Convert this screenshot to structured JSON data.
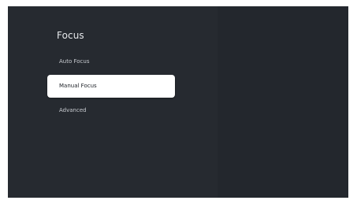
{
  "panel": {
    "title": "Focus"
  },
  "menu": {
    "items": [
      {
        "label": "Auto Focus",
        "selected": false
      },
      {
        "label": "Manual Focus",
        "selected": true
      },
      {
        "label": "Advanced",
        "selected": false
      }
    ]
  },
  "colors": {
    "screen_background": "#23272d",
    "panel_background": "#262a30",
    "selected_background": "#ffffff",
    "text": "#c9ccd1",
    "selected_text": "#20242a"
  }
}
